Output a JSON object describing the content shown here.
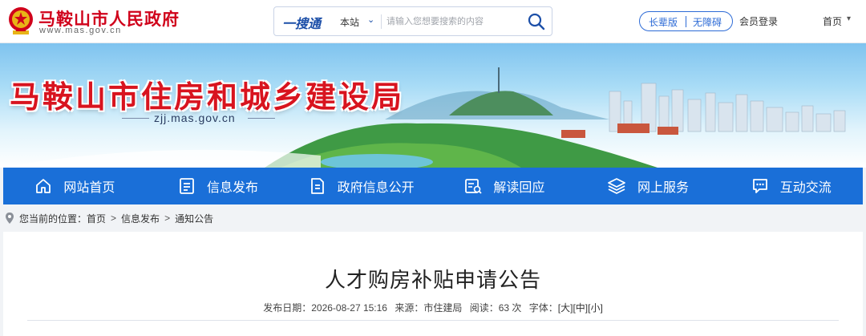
{
  "header": {
    "site_title": "马鞍山市人民政府",
    "site_url": "www.mas.gov.cn",
    "search": {
      "brand_main": "一搜",
      "brand_suffix": "通",
      "scope": "本站",
      "placeholder": "请输入您想要搜索的内容"
    },
    "modes": {
      "elder": "长辈版",
      "accessible": "无障碍"
    },
    "login": "会员登录",
    "home": "首页"
  },
  "banner": {
    "title": "马鞍山市住房和城乡建设局",
    "url": "zjj.mas.gov.cn"
  },
  "nav": {
    "items": [
      {
        "label": "网站首页",
        "icon": "home-icon"
      },
      {
        "label": "信息发布",
        "icon": "document-list-icon"
      },
      {
        "label": "政府信息公开",
        "icon": "file-icon"
      },
      {
        "label": "解读回应",
        "icon": "interpret-icon"
      },
      {
        "label": "网上服务",
        "icon": "layers-icon"
      },
      {
        "label": "互动交流",
        "icon": "chat-icon"
      }
    ]
  },
  "breadcrumb": {
    "prefix": "您当前的位置：",
    "items": [
      "首页",
      "信息发布",
      "通知公告"
    ]
  },
  "article": {
    "title": "人才购房补贴申请公告",
    "date_label": "发布日期：",
    "date": "2026-08-27 15:16",
    "source_label": "来源：",
    "source": "市住建局",
    "views_label": "阅读：",
    "views": "63 次",
    "font_label": "字体：",
    "font_large": "[大]",
    "font_medium": "[中]",
    "font_small": "[小]"
  },
  "colors": {
    "brand_red": "#d0021b",
    "nav_blue": "#1a6fd8",
    "accent_blue": "#2d6bd6"
  }
}
